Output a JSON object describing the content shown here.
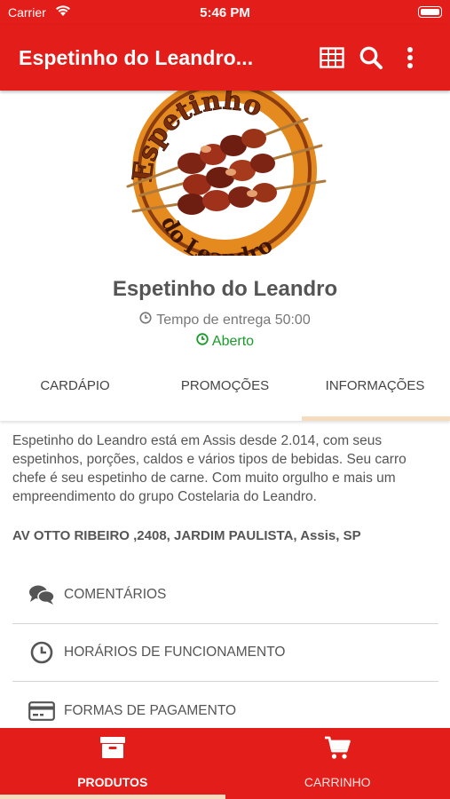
{
  "status_bar": {
    "carrier": "Carrier",
    "time": "5:46 PM"
  },
  "app_bar": {
    "title": "Espetinho do Leandro..."
  },
  "store": {
    "name": "Espetinho do Leandro",
    "delivery_time": "Tempo de entrega 50:00",
    "status": "Aberto",
    "logo_text_top": "Espetinho",
    "logo_text_bottom": "do Leandro"
  },
  "tabs": [
    {
      "label": "CARDÁPIO",
      "active": false
    },
    {
      "label": "PROMOÇÕES",
      "active": false
    },
    {
      "label": "INFORMAÇÕES",
      "active": true
    }
  ],
  "about": "Espetinho do Leandro está em Assis desde 2.014, com seus espetinhos, porções, caldos e vários tipos de bebidas. Seu carro chefe é seu espetinho de carne. Com muito orgulho e mais um empreendimento do grupo Costelaria do Leandro.",
  "address": "AV OTTO RIBEIRO ,2408, JARDIM PAULISTA, Assis, SP",
  "info_items": [
    {
      "label": "COMENTÁRIOS",
      "icon": "comments-icon"
    },
    {
      "label": "HORÁRIOS DE FUNCIONAMENTO",
      "icon": "clock-icon"
    },
    {
      "label": "FORMAS DE PAGAMENTO",
      "icon": "credit-card-icon"
    }
  ],
  "bottom_nav": [
    {
      "label": "PRODUTOS",
      "icon": "archive-box-icon",
      "active": true
    },
    {
      "label": "CARRINHO",
      "icon": "cart-icon",
      "active": false
    }
  ],
  "colors": {
    "primary": "#e31d1a",
    "open": "#1a9a2a",
    "accent_underline": "#f5dcbf",
    "logo_orange": "#e58a1f"
  }
}
